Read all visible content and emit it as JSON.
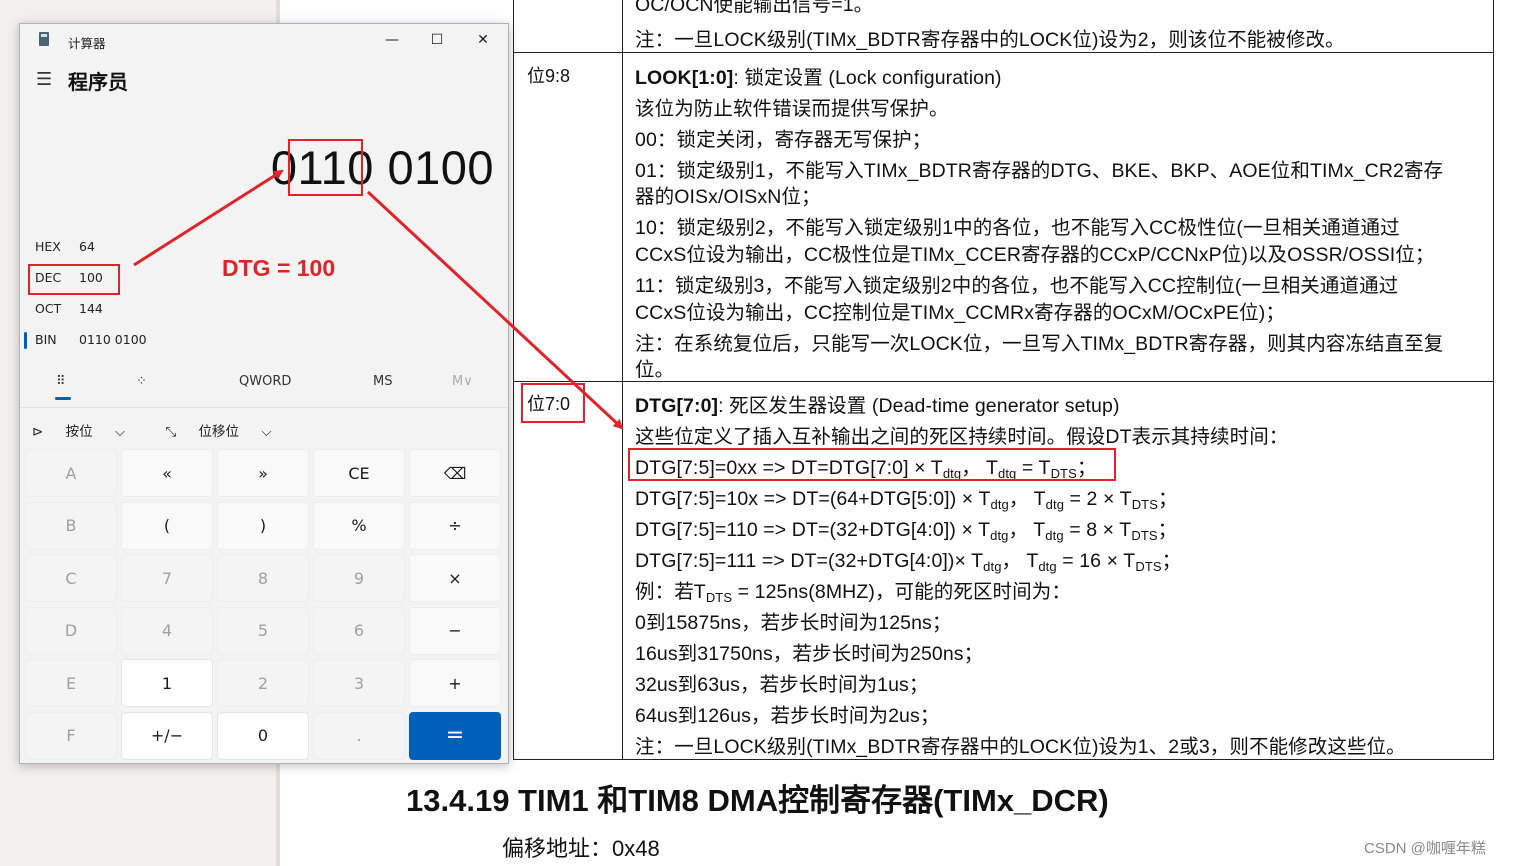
{
  "calculator": {
    "app_title": "计算器",
    "mode_title": "程序员",
    "display_value": "0110 0100",
    "radix": [
      {
        "label": "HEX",
        "value": "64"
      },
      {
        "label": "DEC",
        "value": "100"
      },
      {
        "label": "OCT",
        "value": "144"
      },
      {
        "label": "BIN",
        "value": "0110 0100"
      }
    ],
    "word_size": "QWORD",
    "memory_store": "MS",
    "memory_recall": "M∨",
    "bitwise_label": "按位",
    "bitshift_label": "位移位",
    "keys": [
      [
        "A",
        "«",
        "»",
        "CE",
        "⌫"
      ],
      [
        "B",
        "(",
        ")",
        "%",
        "÷"
      ],
      [
        "C",
        "7",
        "8",
        "9",
        "×"
      ],
      [
        "D",
        "4",
        "5",
        "6",
        "−"
      ],
      [
        "E",
        "1",
        "2",
        "3",
        "+"
      ],
      [
        "F",
        "+/−",
        "0",
        ".",
        "="
      ]
    ],
    "accent_color": "#005fb8"
  },
  "annotation": {
    "text": "DTG = 100",
    "color": "#e0232a"
  },
  "document": {
    "top_partial_1": "OC/OCN使能输出信号=1。",
    "top_partial_2": "注：一旦LOCK级别(TIMx_BDTR寄存器中的LOCK位)设为2，则该位不能被修改。",
    "row_lock": {
      "bits": "位9:8",
      "title_bold": "LOOK[1:0]",
      "title_rest": ": 锁定设置 (Lock configuration)",
      "lines": [
        "该位为防止软件错误而提供写保护。",
        "00：锁定关闭，寄存器无写保护；",
        "01：锁定级别1，不能写入TIMx_BDTR寄存器的DTG、BKE、BKP、AOE位和TIMx_CR2寄存",
        "器的OISx/OISxN位；",
        "10：锁定级别2，不能写入锁定级别1中的各位，也不能写入CC极性位(一旦相关通道通过",
        "CCxS位设为输出，CC极性位是TIMx_CCER寄存器的CCxP/CCNxP位)以及OSSR/OSSI位；",
        "11：锁定级别3，不能写入锁定级别2中的各位，也不能写入CC控制位(一旦相关通道通过",
        "CCxS位设为输出，CC控制位是TIMx_CCMRx寄存器的OCxM/OCxPE位)；",
        "注：在系统复位后，只能写一次LOCK位，一旦写入TIMx_BDTR寄存器，则其内容冻结直至复",
        "位。"
      ]
    },
    "row_dtg": {
      "bits": "位7:0",
      "title_bold": "DTG[7:0]",
      "title_rest": ": 死区发生器设置 (Dead-time generator setup)",
      "intro": "这些位定义了插入互补输出之间的死区持续时间。假设DT表示其持续时间：",
      "formula1": "DTG[7:5]=0xx => DT=DTG[7:0] × T",
      "formula2": "DTG[7:5]=10x => DT=(64+DTG[5:0]) × T",
      "formula3": "DTG[7:5]=110 => DT=(32+DTG[4:0]) × T",
      "formula4": "DTG[7:5]=111 => DT=(32+DTG[4:0])× T",
      "sub_dtg": "dtg",
      "sub_dts": "DTS",
      "t": "T",
      "eq_1": " = T",
      "eq_2": " = 2 × T",
      "eq_3": " = 8 × T",
      "eq_4": " = 16 × T",
      "sep": "，",
      "end": "；",
      "example_pre": "例：若T",
      "example_post": " = 125ns(8MHZ)，可能的死区时间为：",
      "ranges": [
        "0到15875ns，若步长时间为125ns；",
        "16us到31750ns，若步长时间为250ns；",
        "32us到63us，若步长时间为1us；",
        "64us到126us，若步长时间为2us；",
        "注：一旦LOCK级别(TIMx_BDTR寄存器中的LOCK位)设为1、2或3，则不能修改这些位。"
      ]
    },
    "section_heading": "13.4.19  TIM1 和TIM8 DMA控制寄存器(TIMx_DCR)",
    "offset_label": "偏移地址：0x48",
    "watermark": "CSDN @咖喱年糕"
  }
}
